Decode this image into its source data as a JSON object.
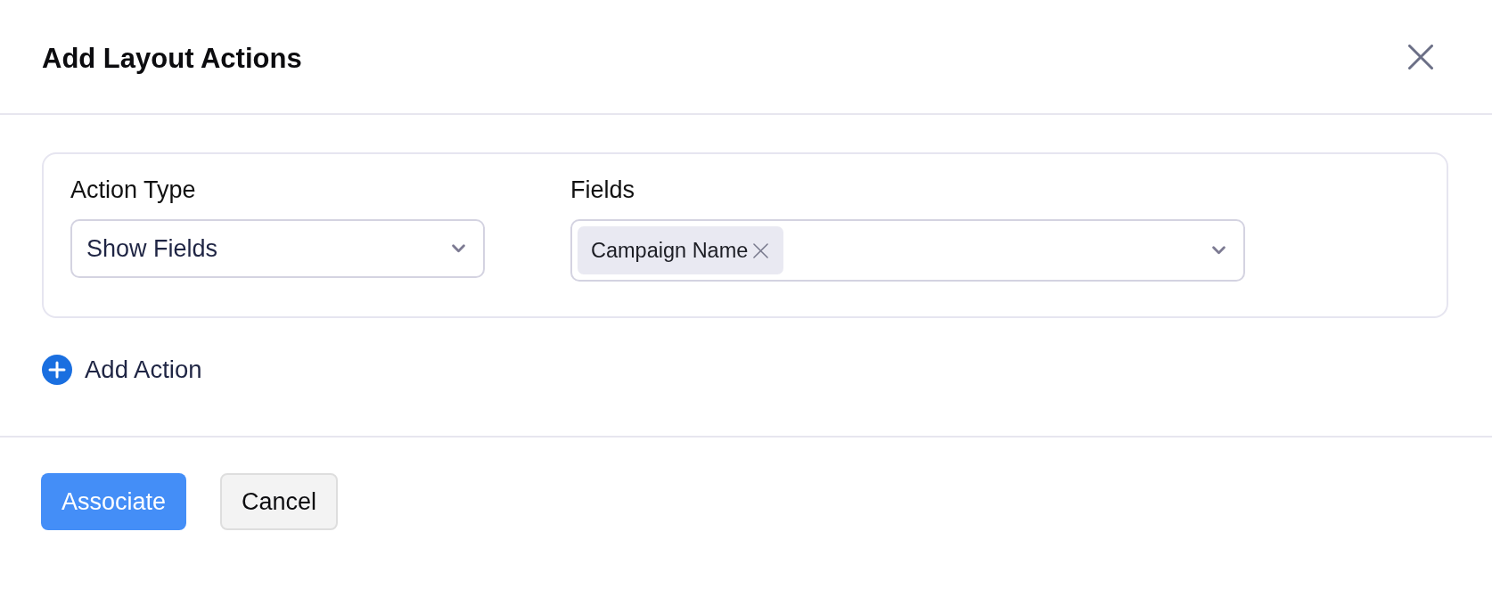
{
  "dialog": {
    "title": "Add Layout Actions"
  },
  "actions": [
    {
      "action_type": {
        "label": "Action Type",
        "value": "Show Fields"
      },
      "fields": {
        "label": "Fields",
        "chips": [
          "Campaign Name"
        ]
      }
    }
  ],
  "add_action": {
    "label": "Add Action"
  },
  "buttons": [
    {
      "label": "Associate",
      "kind": "primary"
    },
    {
      "label": "Cancel",
      "kind": "secondary"
    }
  ]
}
